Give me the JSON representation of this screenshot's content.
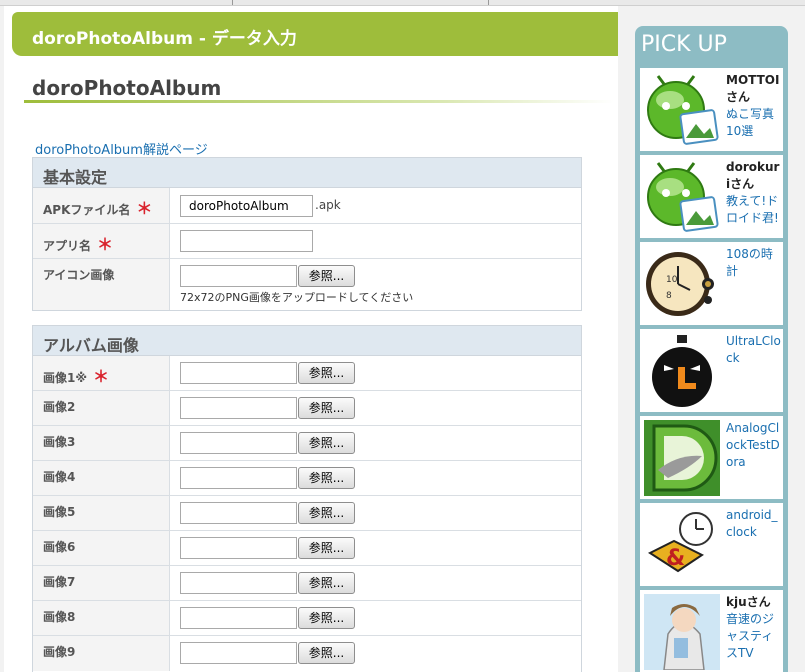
{
  "header": {
    "title": "doroPhotoAlbum - データ入力"
  },
  "page": {
    "title": "doroPhotoAlbum",
    "description_link": "doroPhotoAlbum解説ページ"
  },
  "basic": {
    "heading": "基本設定",
    "apk_label": "APKファイル名",
    "apk_value": "doroPhotoAlbum",
    "apk_suffix": ".apk",
    "app_label": "アプリ名",
    "app_value": "",
    "icon_label": "アイコン画像",
    "icon_hint": "72x72のPNG画像をアップロードしてください",
    "required_mark": "＊"
  },
  "album": {
    "heading": "アルバム画像",
    "rows": [
      "画像1※",
      "画像2",
      "画像3",
      "画像4",
      "画像5",
      "画像6",
      "画像7",
      "画像8",
      "画像9"
    ]
  },
  "browse_label": "参照...",
  "sidebar": {
    "heading": "PICK UP",
    "cards": [
      {
        "bold": "MOTTOIさん",
        "link": "ぬこ写真10選",
        "icon": "android-robot-photo-icon"
      },
      {
        "bold": "dorokuriさん",
        "link": "教えて!ドロイド君!",
        "icon": "android-robot-photo-icon"
      },
      {
        "bold": "",
        "link": "108の時計",
        "icon": "pocket-watch-icon"
      },
      {
        "bold": "",
        "link": "UltraLClock",
        "icon": "stopwatch-icon"
      },
      {
        "bold": "",
        "link": "AnalogClockTestDora",
        "icon": "d-logo-icon"
      },
      {
        "bold": "",
        "link": "android_clock",
        "icon": "clock-emblem-icon"
      },
      {
        "bold": "kjuさん",
        "link": "音速のジャスティスTV",
        "icon": "anime-character-icon"
      }
    ]
  },
  "colors": {
    "header": "#9ebd3b",
    "sidebar": "#8dbcc4",
    "link": "#1a6fb0",
    "required": "#d9232d"
  }
}
